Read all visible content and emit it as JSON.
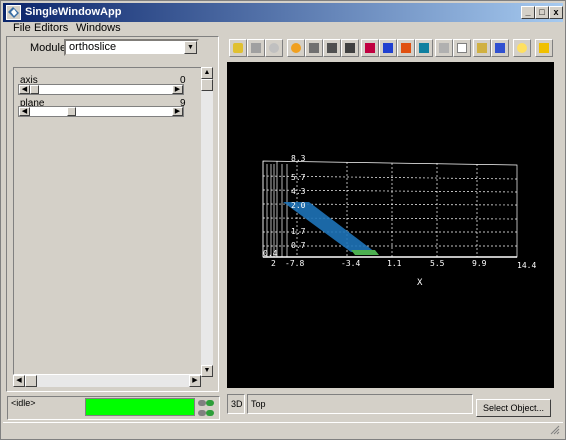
{
  "window": {
    "title": "SingleWindowApp",
    "minimize_label": "_",
    "maximize_label": "□",
    "close_label": "x"
  },
  "menu": {
    "items": [
      "File",
      "Editors",
      "Windows"
    ]
  },
  "modules": {
    "label": "Modules",
    "selected": "orthoslice"
  },
  "parameters": [
    {
      "name": "axis",
      "value": "0",
      "fraction": 0.0
    },
    {
      "name": "plane",
      "value": "9",
      "fraction": 0.28
    }
  ],
  "toolbar": {
    "icons": [
      "camera-icon",
      "render-icon",
      "person-icon",
      "rotate-icon",
      "zoom-box-icon",
      "translate-icon",
      "pan-cross-icon",
      "color-cube-red-icon",
      "color-cube-blue-icon",
      "color-cube-orange-icon",
      "color-cube-teal-icon",
      "grid-panel-icon",
      "table-panel-icon",
      "layout-icon",
      "window-icon",
      "light-icon",
      "lightning-icon"
    ]
  },
  "viewport": {
    "x_axis_label": "X",
    "x_ticks": [
      "2",
      "-7.8",
      "-3.4",
      "1.1",
      "5.5",
      "9.9",
      "14.4"
    ],
    "y_ticks": [
      "8.3",
      "5.7",
      "4.3",
      "2.0",
      "1.7",
      "0.7",
      "0.4"
    ],
    "background": "#000000",
    "slice_color": "#1e73b8",
    "accent_color": "#4caf50"
  },
  "status": {
    "idle_text": "<idle>",
    "progress_color": "#00ff00"
  },
  "bottom": {
    "mode_3d": "3D",
    "view_label": "Top",
    "select_button": "Select Object..."
  }
}
